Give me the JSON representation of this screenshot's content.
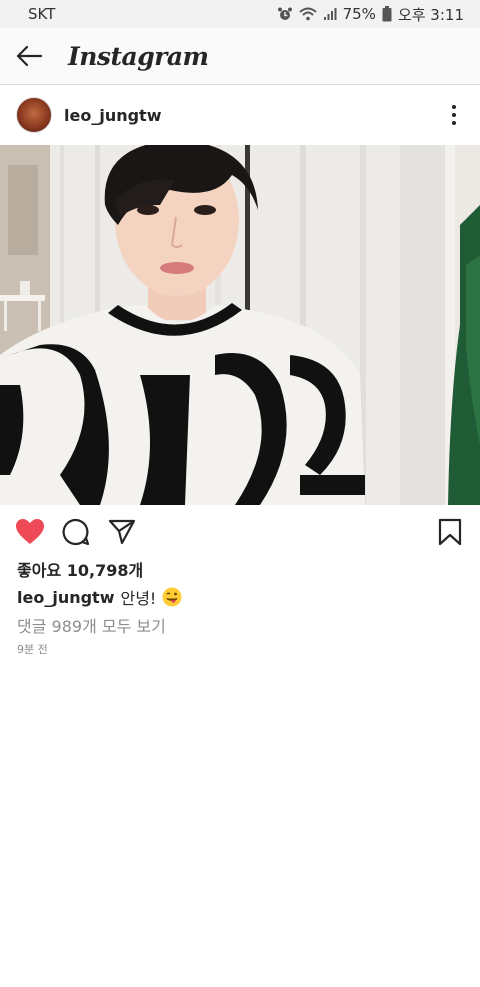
{
  "status_bar": {
    "carrier": "SKT",
    "battery": "75%",
    "time": "오후 3:11",
    "icons": [
      "alarm-icon",
      "wifi-icon",
      "signal-icon",
      "battery-icon"
    ]
  },
  "header": {
    "title": "Instagram",
    "back_icon": "arrow-left-icon"
  },
  "post": {
    "username": "leo_jungtw",
    "more_icon": "more-vertical-icon",
    "liked": true,
    "like_color": "#ed4956",
    "likes_text": "좋아요 10,798개",
    "caption_user": "leo_jungtw",
    "caption_text": "안녕!",
    "caption_emoji": "tongue-wink-emoji",
    "comments_text": "댓글 989개 모두 보기",
    "time_ago": "9분 전"
  }
}
